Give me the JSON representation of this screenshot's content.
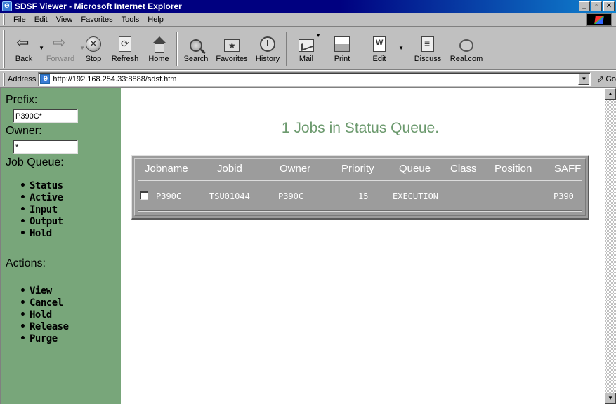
{
  "window": {
    "title": "SDSF Viewer - Microsoft Internet Explorer",
    "min_glyph": "_",
    "max_glyph": "▫",
    "close_glyph": "✕"
  },
  "menu": {
    "items": [
      "File",
      "Edit",
      "View",
      "Favorites",
      "Tools",
      "Help"
    ]
  },
  "toolbar": {
    "back": "Back",
    "forward": "Forward",
    "stop": "Stop",
    "refresh": "Refresh",
    "home": "Home",
    "search": "Search",
    "favorites": "Favorites",
    "history": "History",
    "mail": "Mail",
    "print": "Print",
    "edit": "Edit",
    "discuss": "Discuss",
    "realcom": "Real.com"
  },
  "address": {
    "label": "Address",
    "url": "http://192.168.254.33:8888/sdsf.htm",
    "go": "Go"
  },
  "sidebar": {
    "prefix_label": "Prefix:",
    "prefix_value": "P390C*",
    "owner_label": "Owner:",
    "owner_value": "*",
    "job_queue_label": "Job Queue:",
    "queues": [
      "Status",
      "Active",
      "Input",
      "Output",
      "Hold"
    ],
    "actions_label": "Actions:",
    "actions": [
      "View",
      "Cancel",
      "Hold",
      "Release",
      "Purge"
    ]
  },
  "main": {
    "title": "1 Jobs in Status Queue.",
    "columns": [
      "Jobname",
      "Jobid",
      "Owner",
      "Priority",
      "Queue",
      "Class",
      "Position",
      "SAFF"
    ],
    "rows": [
      {
        "checked": false,
        "jobname": "P390C",
        "jobid": "TSU01044",
        "owner": "P390C",
        "priority": "15",
        "queue": "EXECUTION",
        "class": "",
        "position": "",
        "saff": "P390"
      }
    ]
  },
  "colors": {
    "sidebar_bg": "#78a67a",
    "title_text": "#6c9a6e",
    "table_bg": "#9c9c9c",
    "titlebar": "#000080"
  }
}
